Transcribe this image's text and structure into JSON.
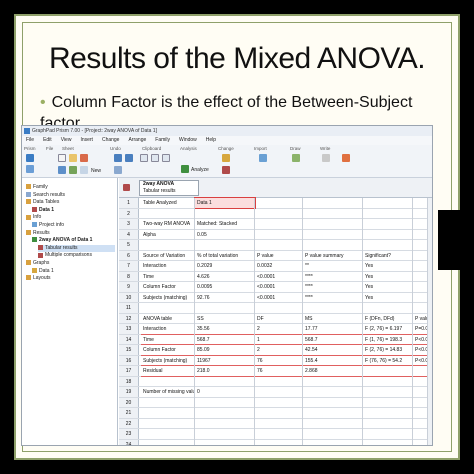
{
  "slide": {
    "title": "Results of the Mixed ANOVA.",
    "bullet": "Column Factor is the effect of the Between-Subject factor."
  },
  "window": {
    "title": "GraphPad Prism 7.00 - [Project: 2way ANOVA of Data 1]",
    "menu": [
      "File",
      "Edit",
      "View",
      "Insert",
      "Change",
      "Arrange",
      "Family",
      "Window",
      "Help"
    ],
    "ribbon_groups": [
      "Prism",
      "File",
      "Sheet",
      "Undo",
      "Clipboard",
      "Analysis",
      "Change",
      "Import",
      "Draw",
      "Write"
    ],
    "analyze_label": "Analyze",
    "new_label": "New"
  },
  "nav": {
    "items": [
      {
        "label": "Family",
        "level": 0
      },
      {
        "label": "Search results",
        "level": 0
      },
      {
        "label": "Data Tables",
        "level": 0
      },
      {
        "label": "Data 1",
        "level": 1,
        "bold": true
      },
      {
        "label": "Info",
        "level": 0
      },
      {
        "label": "Project info",
        "level": 1
      },
      {
        "label": "Results",
        "level": 0
      },
      {
        "label": "2way ANOVA of Data 1",
        "level": 1,
        "bold": true
      },
      {
        "label": "Tabular results",
        "level": 2,
        "selected": true
      },
      {
        "label": "Multiple comparisons",
        "level": 2
      },
      {
        "label": "Graphs",
        "level": 0
      },
      {
        "label": "Data 1",
        "level": 1
      },
      {
        "label": "Layouts",
        "level": 0
      }
    ]
  },
  "sheet": {
    "tab_title": "2way ANOVA",
    "tab_subtitle": "Tabular results",
    "rows": [
      {
        "n": "1",
        "a": "Table Analyzed",
        "b": "Data 1",
        "c": "",
        "d": "",
        "e": "",
        "f": ""
      },
      {
        "n": "2",
        "a": "",
        "b": "",
        "c": "",
        "d": "",
        "e": "",
        "f": ""
      },
      {
        "n": "3",
        "a": "Two-way RM ANOVA",
        "b": "Matched: Stacked",
        "c": "",
        "d": "",
        "e": "",
        "f": ""
      },
      {
        "n": "4",
        "a": "Alpha",
        "b": "0.05",
        "c": "",
        "d": "",
        "e": "",
        "f": ""
      },
      {
        "n": "5",
        "a": "",
        "b": "",
        "c": "",
        "d": "",
        "e": "",
        "f": ""
      },
      {
        "n": "6",
        "a": "Source of Variation",
        "b": "% of total variation",
        "c": "P value",
        "d": "P value summary",
        "e": "Significant?",
        "f": ""
      },
      {
        "n": "7",
        "a": "Interaction",
        "b": "0.2029",
        "c": "0.0032",
        "d": "**",
        "e": "Yes",
        "f": ""
      },
      {
        "n": "8",
        "a": "Time",
        "b": "4.626",
        "c": "<0.0001",
        "d": "****",
        "e": "Yes",
        "f": ""
      },
      {
        "n": "9",
        "a": "Column Factor",
        "b": "0.0095",
        "c": "<0.0001",
        "d": "****",
        "e": "Yes",
        "f": ""
      },
      {
        "n": "10",
        "a": "Subjects (matching)",
        "b": "92.76",
        "c": "<0.0001",
        "d": "****",
        "e": "Yes",
        "f": ""
      },
      {
        "n": "11",
        "a": "",
        "b": "",
        "c": "",
        "d": "",
        "e": "",
        "f": ""
      },
      {
        "n": "12",
        "a": "ANOVA table",
        "b": "SS",
        "c": "DF",
        "d": "MS",
        "e": "F (DFn, DFd)",
        "f": "P value"
      },
      {
        "n": "13",
        "a": "Interaction",
        "b": "35.56",
        "c": "2",
        "d": "17.77",
        "e": "F (2, 76) = 6.197",
        "f": "P=0.0032"
      },
      {
        "n": "14",
        "a": "Time",
        "b": "568.7",
        "c": "1",
        "d": "568.7",
        "e": "F (1, 76) = 198.3",
        "f": "P<0.0001"
      },
      {
        "n": "15",
        "a": "Column Factor",
        "b": "85.09",
        "c": "2",
        "d": "42.54",
        "e": "F (2, 76) = 14.83",
        "f": "P<0.0001"
      },
      {
        "n": "16",
        "a": "Subjects (matching)",
        "b": "11967",
        "c": "76",
        "d": "155.4",
        "e": "F (76, 76) = 54.2",
        "f": "P<0.0001"
      },
      {
        "n": "17",
        "a": "Residual",
        "b": "218.0",
        "c": "76",
        "d": "2.868",
        "e": "",
        "f": ""
      },
      {
        "n": "18",
        "a": "",
        "b": "",
        "c": "",
        "d": "",
        "e": "",
        "f": ""
      },
      {
        "n": "19",
        "a": "Number of missing values",
        "b": "0",
        "c": "",
        "d": "",
        "e": "",
        "f": ""
      },
      {
        "n": "20",
        "a": "",
        "b": "",
        "c": "",
        "d": "",
        "e": "",
        "f": ""
      },
      {
        "n": "21",
        "a": "",
        "b": "",
        "c": "",
        "d": "",
        "e": "",
        "f": ""
      },
      {
        "n": "22",
        "a": "",
        "b": "",
        "c": "",
        "d": "",
        "e": "",
        "f": ""
      },
      {
        "n": "23",
        "a": "",
        "b": "",
        "c": "",
        "d": "",
        "e": "",
        "f": ""
      },
      {
        "n": "24",
        "a": "",
        "b": "",
        "c": "",
        "d": "",
        "e": "",
        "f": ""
      },
      {
        "n": "25",
        "a": "",
        "b": "",
        "c": "",
        "d": "",
        "e": "",
        "f": ""
      }
    ]
  },
  "colors": {
    "slide_bg": "#fffdf4",
    "frame": "#8fa06a",
    "bullet": "#9bb064",
    "highlight_red": "#d94040"
  }
}
